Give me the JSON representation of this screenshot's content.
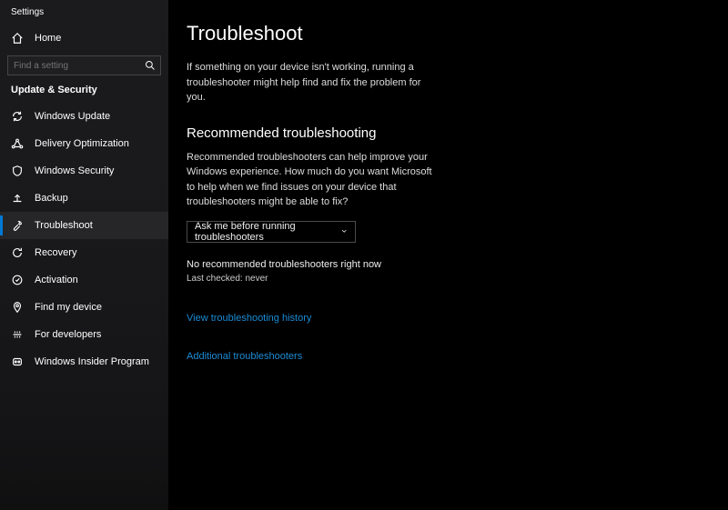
{
  "app": {
    "title": "Settings"
  },
  "home": {
    "label": "Home"
  },
  "search": {
    "placeholder": "Find a setting"
  },
  "section": {
    "title": "Update & Security"
  },
  "nav": [
    {
      "label": "Windows Update",
      "icon": "refresh-icon",
      "selected": false
    },
    {
      "label": "Delivery Optimization",
      "icon": "delivery-icon",
      "selected": false
    },
    {
      "label": "Windows Security",
      "icon": "shield-icon",
      "selected": false
    },
    {
      "label": "Backup",
      "icon": "backup-icon",
      "selected": false
    },
    {
      "label": "Troubleshoot",
      "icon": "troubleshoot-icon",
      "selected": true
    },
    {
      "label": "Recovery",
      "icon": "recovery-icon",
      "selected": false
    },
    {
      "label": "Activation",
      "icon": "activation-icon",
      "selected": false
    },
    {
      "label": "Find my device",
      "icon": "find-device-icon",
      "selected": false
    },
    {
      "label": "For developers",
      "icon": "developers-icon",
      "selected": false
    },
    {
      "label": "Windows Insider Program",
      "icon": "insider-icon",
      "selected": false
    }
  ],
  "main": {
    "title": "Troubleshoot",
    "intro": "If something on your device isn't working, running a troubleshooter might help find and fix the problem for you.",
    "recommended": {
      "heading": "Recommended troubleshooting",
      "desc": "Recommended troubleshooters can help improve your Windows experience. How much do you want Microsoft to help when we find issues on your device that troubleshooters might be able to fix?",
      "dropdown_value": "Ask me before running troubleshooters",
      "status": "No recommended troubleshooters right now",
      "last_checked": "Last checked: never"
    },
    "links": {
      "history": "View troubleshooting history",
      "additional": "Additional troubleshooters"
    }
  }
}
